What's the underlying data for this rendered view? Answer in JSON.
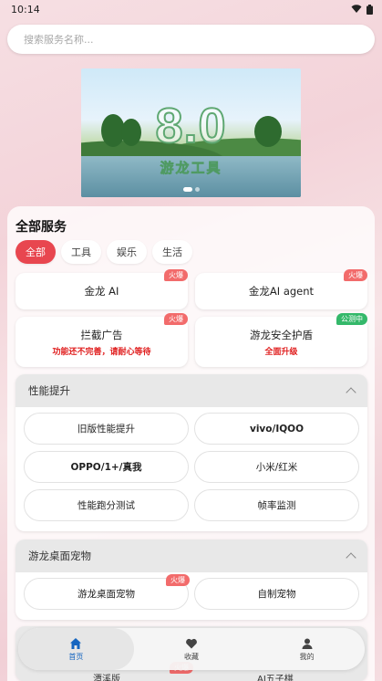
{
  "status": {
    "time": "10:14"
  },
  "search": {
    "placeholder": "搜索服务名称..."
  },
  "banner": {
    "title": "8.0",
    "subtitle": "游龙工具"
  },
  "panel": {
    "title": "全部服务",
    "tabs": [
      "全部",
      "工具",
      "娱乐",
      "生活"
    ]
  },
  "cards": [
    {
      "title": "金龙 AI",
      "badge": "火爆"
    },
    {
      "title": "金龙AI agent",
      "badge": "火爆"
    },
    {
      "title": "拦截广告",
      "subtitle": "功能还不完善，请耐心等待",
      "badge": "火爆"
    },
    {
      "title": "游龙安全护盾",
      "subtitle": "全面升级",
      "badge": "公测中"
    }
  ],
  "sections": [
    {
      "title": "性能提升",
      "items": [
        "旧版性能提升",
        "vivo/IQOO",
        "OPPO/1+/真我",
        "小米/红米",
        "性能跑分测试",
        "帧率监测"
      ]
    },
    {
      "title": "游龙桌面宠物",
      "items": [
        "游龙桌面宠物",
        "自制宠物"
      ],
      "badge": "火爆"
    }
  ],
  "peek": {
    "badge": "火爆",
    "left": "潭溪版",
    "right": "AI五子棋"
  },
  "nav": [
    {
      "label": "首页",
      "icon": "home-icon"
    },
    {
      "label": "收藏",
      "icon": "heart-icon"
    },
    {
      "label": "我的",
      "icon": "person-icon"
    }
  ],
  "colors": {
    "accent": "#e8464f",
    "active_nav": "#1565c0",
    "badge_hot": "#f26b6b",
    "badge_beta": "#34b86a"
  }
}
